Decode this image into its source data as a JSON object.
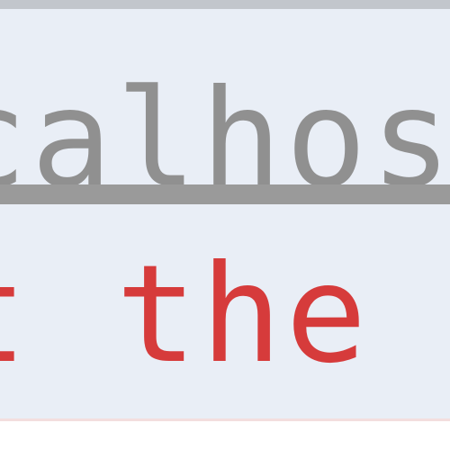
{
  "page": {
    "url_fragment": "calhost",
    "message_fragment": "t the m",
    "colors": {
      "panel_background": "#e9eef6",
      "url_text": "#909090",
      "message_text": "#d63b3b"
    }
  }
}
